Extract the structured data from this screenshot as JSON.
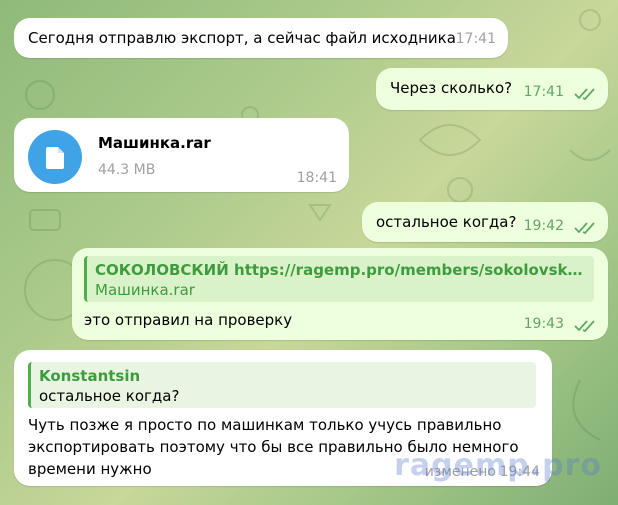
{
  "messages": {
    "m1": {
      "text": "Сегодня отправлю экспорт, а сейчас файл исходника",
      "time": "17:41"
    },
    "m2": {
      "text": "Через сколько?",
      "time": "17:41"
    },
    "m3": {
      "file_name": "Машинка.rar",
      "file_size": "44.3 MB",
      "time": "18:41"
    },
    "m4": {
      "text": "остальное когда?",
      "time": "19:42"
    },
    "m5": {
      "reply_author": "СОКОЛОВСКИЙ",
      "reply_link": "https://ragemp.pro/members/sokolovskij.29...",
      "reply_text": "Машинка.rar",
      "text": "это отправил на проверку",
      "time": "19:43"
    },
    "m6": {
      "reply_author": "Konstantsin",
      "reply_text": "остальное когда?",
      "text": "Чуть позже я просто по машинкам только учусь правильно экспортировать поэтому что бы все правильно было немного времени нужно",
      "edited_label": "изменено",
      "time": "19:44"
    }
  },
  "watermark": "ragemp.pro",
  "colors": {
    "outgoing": "#eeffde",
    "incoming": "#ffffff",
    "accent_green": "#4fae4e",
    "file_icon": "#3fa3e6"
  }
}
